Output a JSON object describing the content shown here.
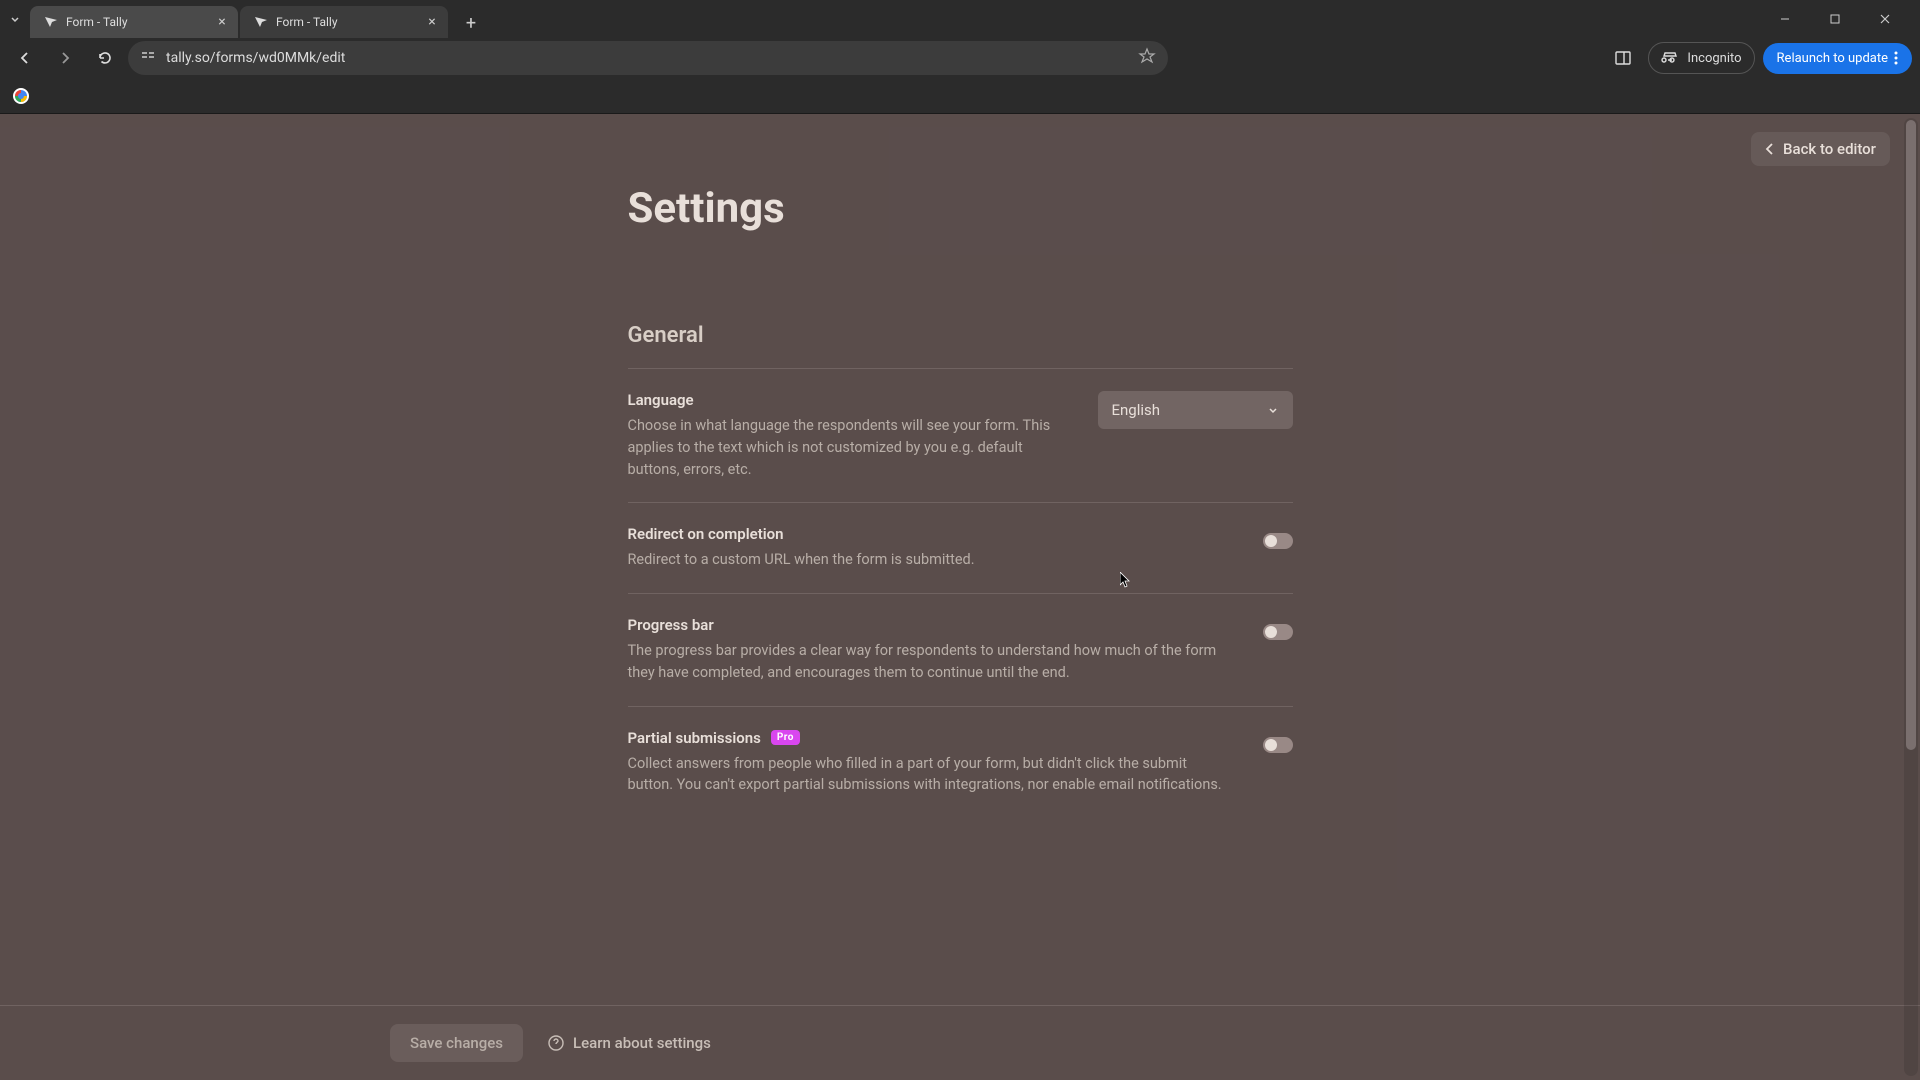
{
  "browser": {
    "tabs": [
      {
        "title": "Form - Tally",
        "active": true
      },
      {
        "title": "Form - Tally",
        "active": false
      }
    ],
    "url": "tally.so/forms/wd0MMk/edit",
    "incognito_label": "Incognito",
    "relaunch_label": "Relaunch to update"
  },
  "page": {
    "back_link": "Back to editor",
    "title": "Settings",
    "section": "General",
    "settings": {
      "language": {
        "label": "Language",
        "desc": "Choose in what language the respondents will see your form. This applies to the text which is not customized by you e.g. default buttons, errors, etc.",
        "value": "English"
      },
      "redirect": {
        "label": "Redirect on completion",
        "desc": "Redirect to a custom URL when the form is submitted."
      },
      "progress": {
        "label": "Progress bar",
        "desc": "The progress bar provides a clear way for respondents to understand how much of the form they have completed, and encourages them to continue until the end."
      },
      "partial": {
        "label": "Partial submissions",
        "badge": "Pro",
        "desc": "Collect answers from people who filled in a part of your form, but didn't click the submit button. You can't export partial submissions with integrations, nor enable email notifications."
      }
    },
    "footer": {
      "save": "Save changes",
      "learn": "Learn about settings"
    }
  }
}
